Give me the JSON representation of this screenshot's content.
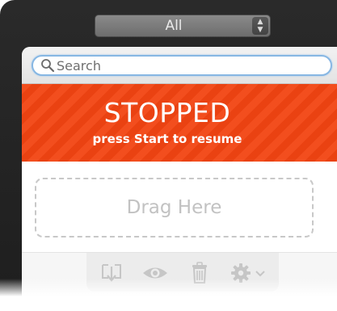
{
  "filter": {
    "selected": "All",
    "arrows_icon": "up-down-arrows-icon"
  },
  "search": {
    "placeholder": "Search",
    "value": "",
    "icon": "search-icon"
  },
  "status": {
    "title": "STOPPED",
    "subtitle": "press Start to resume",
    "color": "#f24412"
  },
  "dropzone": {
    "label": "Drag Here"
  },
  "toolbar": {
    "icons": [
      "download-icon",
      "eye-icon",
      "trash-icon",
      "gear-icon",
      "chevron-down-icon"
    ]
  },
  "colors": {
    "accent_focus": "#87b7e3",
    "icon_gray": "#c6c6c6"
  }
}
